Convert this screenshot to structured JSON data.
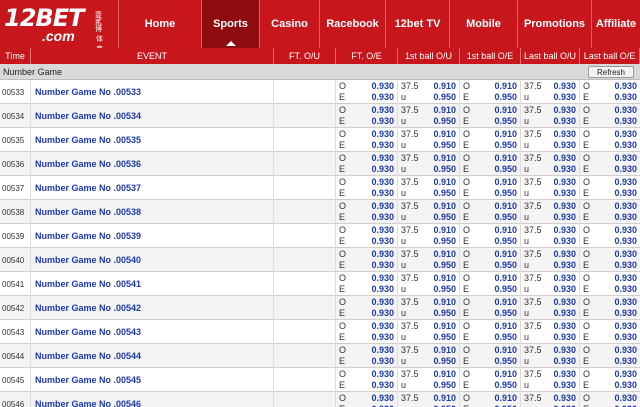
{
  "header": {
    "logo_text": "12BET",
    "logo_sub": ".com",
    "logo_cn": "壹貳博",
    "logo_cn2": "体育",
    "nav": [
      {
        "label": "Home",
        "active": false
      },
      {
        "label": "Sports",
        "active": true
      },
      {
        "label": "Casino",
        "active": false
      },
      {
        "label": "Racebook",
        "active": false
      },
      {
        "label": "12bet TV",
        "active": false
      },
      {
        "label": "Mobile",
        "active": false
      },
      {
        "label": "Promotions",
        "active": false
      },
      {
        "label": "Affiliate",
        "active": false
      }
    ]
  },
  "table": {
    "columns": [
      "Time",
      "EVENT",
      "FT. O/U",
      "FT. O/E",
      "1st ball O/U",
      "1st ball O/E",
      "Last ball O/U",
      "Last ball O/E"
    ],
    "league": "Number Game",
    "refresh_label": "Refresh",
    "market": {
      "ft_ou_top_label": "",
      "ft_ou_top_odds": "",
      "ft_ou_bottom_label": "",
      "ft_ou_bottom_odds": "",
      "ft_oe_top_label": "O",
      "ft_oe_top_odds": "0.930",
      "ft_oe_bottom_label": "E",
      "ft_oe_bottom_odds": "0.930",
      "b1_ou_top_label": "37.5",
      "b1_ou_top_odds": "0.910",
      "b1_ou_bottom_label": "u",
      "b1_ou_bottom_odds": "0.950",
      "b1_oe_top_label": "O",
      "b1_oe_top_odds": "0.910",
      "b1_oe_bottom_label": "E",
      "b1_oe_bottom_odds": "0.950",
      "lb_ou_top_label": "37.5",
      "lb_ou_top_odds": "0.930",
      "lb_ou_bottom_label": "u",
      "lb_ou_bottom_odds": "0.930",
      "lb_oe_top_label": "O",
      "lb_oe_top_odds": "0.930",
      "lb_oe_bottom_label": "E",
      "lb_oe_bottom_odds": "0.930"
    },
    "rows": [
      {
        "time": "00533",
        "event": "Number Game No .00533"
      },
      {
        "time": "00534",
        "event": "Number Game No .00534"
      },
      {
        "time": "00535",
        "event": "Number Game No .00535"
      },
      {
        "time": "00536",
        "event": "Number Game No .00536"
      },
      {
        "time": "00537",
        "event": "Number Game No .00537"
      },
      {
        "time": "00538",
        "event": "Number Game No .00538"
      },
      {
        "time": "00539",
        "event": "Number Game No .00539"
      },
      {
        "time": "00540",
        "event": "Number Game No .00540"
      },
      {
        "time": "00541",
        "event": "Number Game No .00541"
      },
      {
        "time": "00542",
        "event": "Number Game No .00542"
      },
      {
        "time": "00543",
        "event": "Number Game No .00543"
      },
      {
        "time": "00544",
        "event": "Number Game No .00544"
      },
      {
        "time": "00545",
        "event": "Number Game No .00545"
      },
      {
        "time": "00546",
        "event": "Number Game No .00546"
      }
    ]
  },
  "colors": {
    "brand_red": "#c8161d",
    "active_nav": "#8e0c10",
    "odds_blue": "#1e3aa8"
  }
}
